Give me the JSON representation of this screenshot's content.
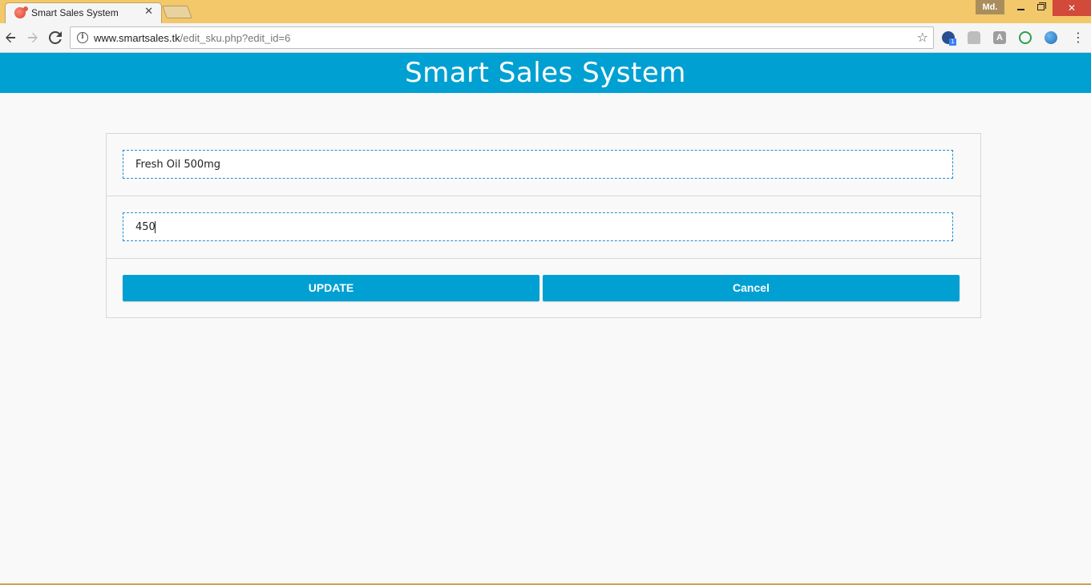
{
  "browser": {
    "tab_title": "Smart Sales System",
    "tab_close": "✕",
    "profile_label": "Md.",
    "url_host": "www.smartsales.tk",
    "url_path": "/edit_sku.php?edit_id=6",
    "extension_badge": "1",
    "extension_a_label": "A",
    "icons": {
      "back": "arrow-left-icon",
      "forward": "arrow-right-icon",
      "reload": "reload-icon",
      "info": "info-icon",
      "bookmark": "star-icon",
      "menu": "more-vert-icon"
    },
    "colors": {
      "frame": "#f2c86b",
      "close": "#d24a3a"
    }
  },
  "app": {
    "title": "Smart Sales System",
    "header_color": "#00a0d2"
  },
  "form": {
    "sku_name": "Fresh Oil 500mg",
    "sku_price": "450",
    "update_label": "UPDATE",
    "cancel_label": "Cancel",
    "button_color": "#00a0d2"
  }
}
